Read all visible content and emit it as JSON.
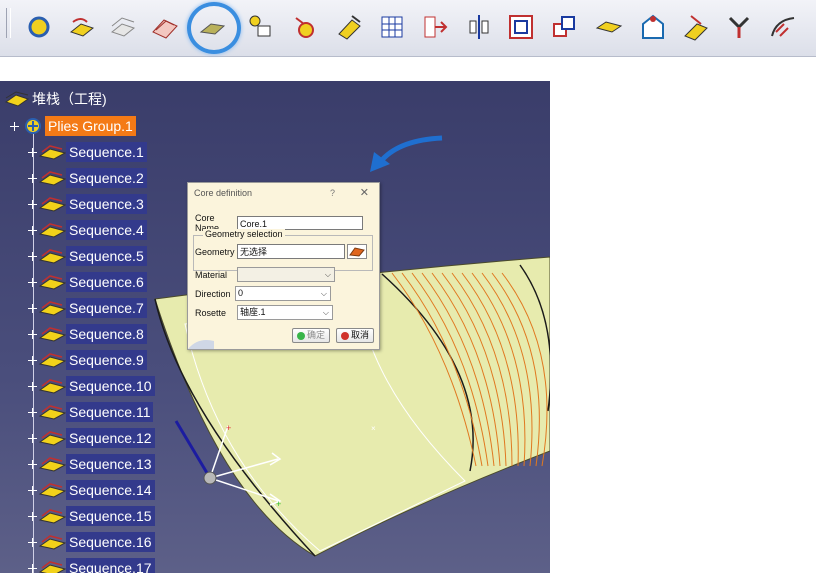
{
  "toolbar": {
    "icons": [
      "composites-params-icon",
      "zone-group-icon",
      "grid-panel-icon",
      "plies-group-icon",
      "core-icon",
      "ply-from-stacking-icon",
      "ply-exploder-icon",
      "manual-ply-icon",
      "material-excess-icon",
      "ply-table-icon",
      "transfer-icon",
      "symmetry-icon",
      "split-icon",
      "cut-piece-icon",
      "flatten-icon",
      "core-sampling-icon",
      "marker-icon",
      "route-icon",
      "rosette-icon"
    ],
    "highlighted": "core-icon"
  },
  "tree": {
    "root_label": "堆栈（工程)",
    "group_label": "Plies Group.1",
    "sequences": [
      "Sequence.1",
      "Sequence.2",
      "Sequence.3",
      "Sequence.4",
      "Sequence.5",
      "Sequence.6",
      "Sequence.7",
      "Sequence.8",
      "Sequence.9",
      "Sequence.10",
      "Sequence.11",
      "Sequence.12",
      "Sequence.13",
      "Sequence.14",
      "Sequence.15",
      "Sequence.16",
      "Sequence.17"
    ]
  },
  "dialog": {
    "title": "Core definition",
    "help": "?",
    "close": "✕",
    "core_name_label": "Core Name",
    "core_name_value": "Core.1",
    "geometry_group": "Geometry selection",
    "geometry_label": "Geometry",
    "geometry_value": "无选择",
    "material_label": "Material",
    "material_value": "",
    "direction_label": "Direction",
    "direction_value": "0",
    "rosette_label": "Rosette",
    "rosette_value": "轴座.1",
    "ok_label": "确定",
    "cancel_label": "取消"
  },
  "colors": {
    "surface": "#e7ebae",
    "ply_lines": "#e07820",
    "selection": "#f47a16",
    "tree_label_bg": "#333a8c"
  }
}
